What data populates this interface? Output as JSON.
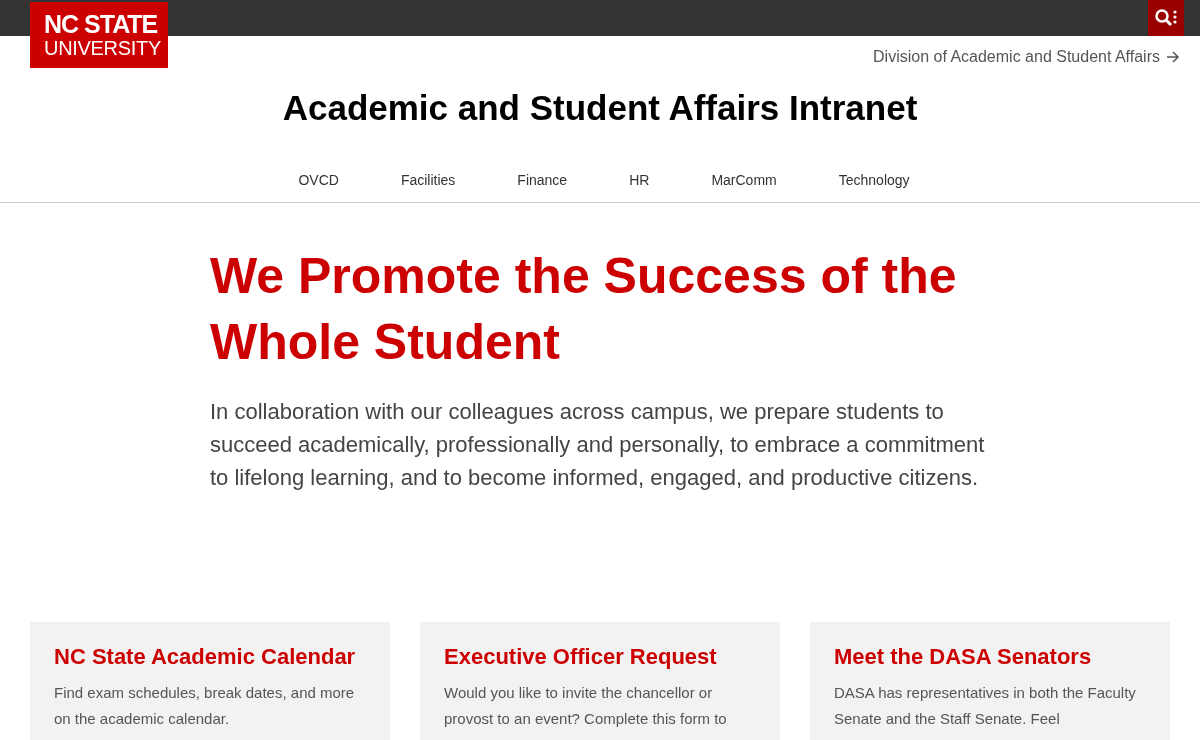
{
  "header": {
    "logo_line_1": "NC STATE",
    "logo_line_2": "UNIVERSITY",
    "division_link": "Division of Academic and Student Affairs"
  },
  "site_title": "Academic and Student Affairs Intranet",
  "nav": [
    {
      "label": "OVCD"
    },
    {
      "label": "Facilities"
    },
    {
      "label": "Finance"
    },
    {
      "label": "HR"
    },
    {
      "label": "MarComm"
    },
    {
      "label": "Technology"
    }
  ],
  "hero": {
    "heading": "We Promote the Success of the Whole Student",
    "text": "In collaboration with our colleagues across campus, we prepare students to succeed academically, professionally and personally, to embrace a commitment to lifelong learning, and to become informed, engaged, and productive citizens."
  },
  "cards": [
    {
      "title": "NC State Academic Calendar",
      "text": "Find exam schedules, break dates, and more on the academic calendar."
    },
    {
      "title": "Executive Officer Request",
      "text": "Would you like to invite the chancellor or provost to an event? Complete this form to"
    },
    {
      "title": "Meet the DASA Senators",
      "text": "DASA has representatives in both the Faculty Senate and the Staff Senate. Feel"
    }
  ]
}
